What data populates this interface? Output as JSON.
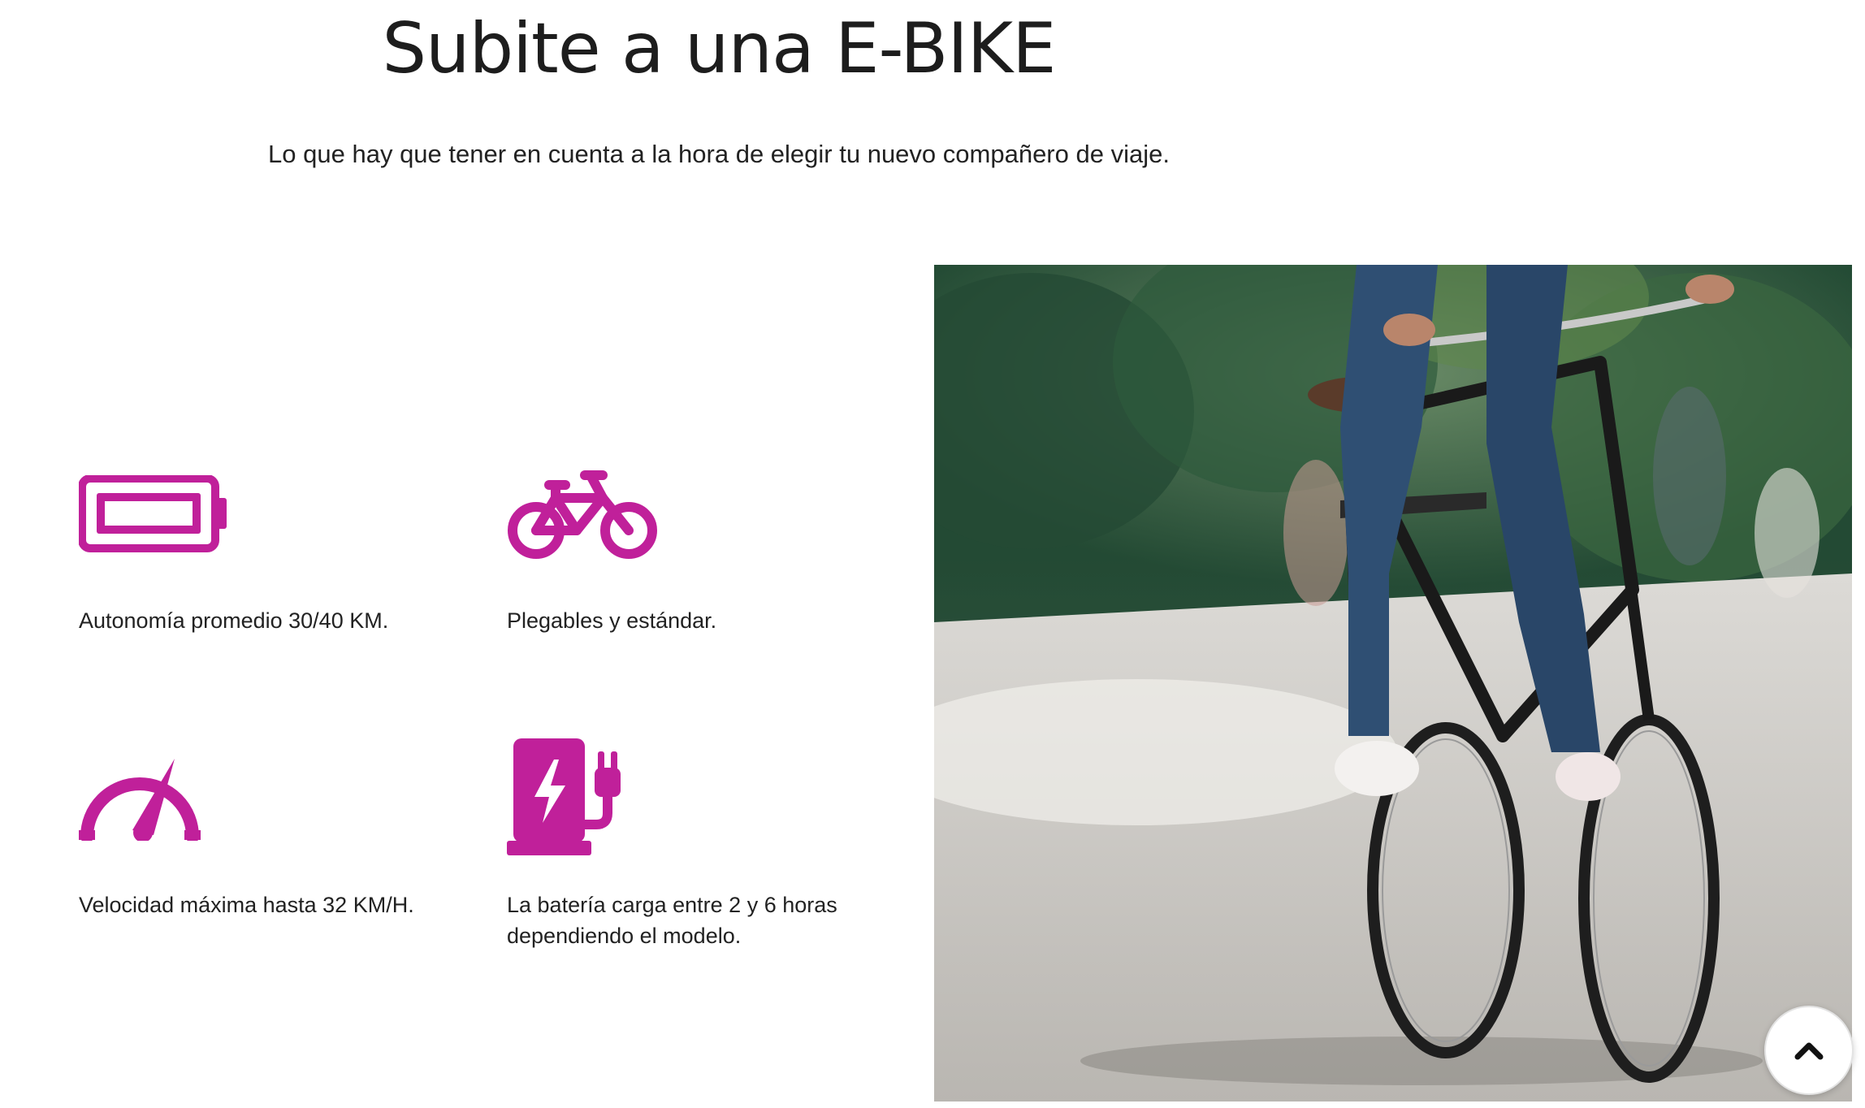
{
  "header": {
    "title": "Subite a una E-BIKE",
    "subtitle": "Lo que hay que tener en cuenta a la hora de elegir tu nuevo compañero de viaje."
  },
  "features": [
    {
      "icon": "battery-icon",
      "label": "Autonomía promedio 30/40 KM."
    },
    {
      "icon": "bicycle-icon",
      "label": "Plegables y estándar."
    },
    {
      "icon": "speedometer-icon",
      "label": "Velocidad máxima hasta 32 KM/H."
    },
    {
      "icon": "charging-station-icon",
      "label": "La batería carga entre 2 y 6 horas dependiendo el modelo."
    }
  ],
  "colors": {
    "accent": "#c0209a",
    "text": "#222222",
    "background": "#ffffff"
  },
  "photo": {
    "icon": "cyclist-photo"
  },
  "scroll_top": {
    "icon": "chevron-up-icon"
  }
}
